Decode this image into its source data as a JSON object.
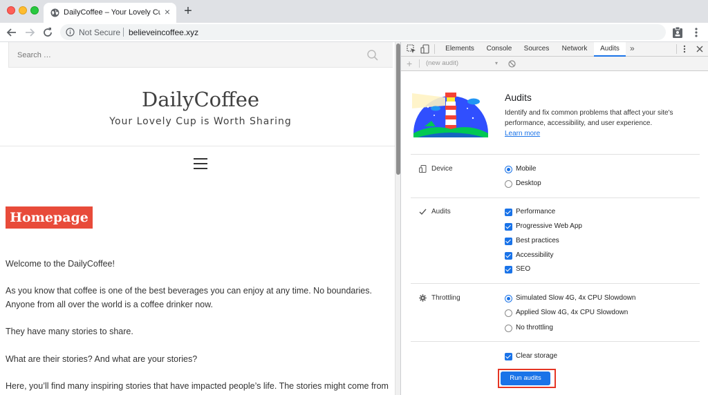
{
  "browser": {
    "tab_title": "DailyCoffee – Your Lovely Cup is Worth Sharing",
    "tab_close": "×",
    "new_tab": "+",
    "security_label": "Not Secure",
    "url": "believeincoffee.xyz"
  },
  "site": {
    "search_placeholder": "Search …",
    "title": "DailyCoffee",
    "tagline": "Your Lovely Cup is Worth Sharing",
    "page_badge": "Homepage",
    "paragraphs": [
      "Welcome to the DailyCoffee!",
      "As you know that coffee is one of the best beverages you can enjoy at any time. No boundaries. Anyone from all over the world is a coffee drinker now.",
      "They have many stories to share.",
      "What are their stories? And what are your stories?",
      "Here, you’ll find many inspiring stories that have impacted people’s life. The stories might come from you."
    ]
  },
  "devtools": {
    "tabs": [
      "Elements",
      "Console",
      "Sources",
      "Network",
      "Audits"
    ],
    "active_tab": "Audits",
    "more_tabs": "»",
    "new_audit_placeholder": "(new audit)",
    "add_label": "+",
    "caret": "▾",
    "panel": {
      "title": "Audits",
      "description": "Identify and fix common problems that affect your site's performance, accessibility, and user experience.",
      "learn_more": "Learn more",
      "device": {
        "label": "Device",
        "options": [
          {
            "label": "Mobile",
            "selected": true
          },
          {
            "label": "Desktop",
            "selected": false
          }
        ]
      },
      "audits": {
        "label": "Audits",
        "options": [
          {
            "label": "Performance",
            "checked": true
          },
          {
            "label": "Progressive Web App",
            "checked": true
          },
          {
            "label": "Best practices",
            "checked": true
          },
          {
            "label": "Accessibility",
            "checked": true
          },
          {
            "label": "SEO",
            "checked": true
          }
        ]
      },
      "throttling": {
        "label": "Throttling",
        "options": [
          {
            "label": "Simulated Slow 4G, 4x CPU Slowdown",
            "selected": true
          },
          {
            "label": "Applied Slow 4G, 4x CPU Slowdown",
            "selected": false
          },
          {
            "label": "No throttling",
            "selected": false
          }
        ]
      },
      "clear_storage": {
        "label": "Clear storage",
        "checked": true
      },
      "run_button": "Run audits"
    }
  },
  "colors": {
    "accent": "#1a73e8",
    "badge": "#e84b3a",
    "highlight": "#e53524"
  }
}
